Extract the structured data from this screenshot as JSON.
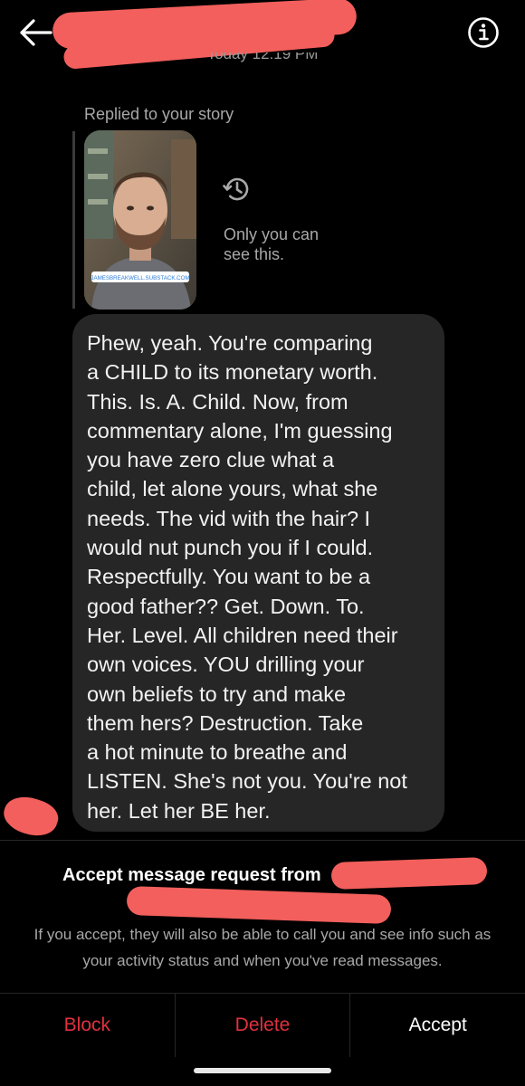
{
  "header": {
    "back_icon": "arrow-left-icon",
    "info_icon": "info-icon"
  },
  "thread": {
    "timestamp": "Today 12:19 PM",
    "reply_label": "Replied to your story",
    "story": {
      "link_label": "JAMESBREAKWELL.SUBSTACK.COM"
    },
    "history_icon": "history-icon",
    "only_you_text": "Only you can\nsee this.",
    "message": "Phew, yeah. You're comparing\na CHILD to its monetary worth.\nThis. Is. A. Child. Now, from\ncommentary alone, I'm guessing\nyou have zero clue what a\nchild, let alone yours, what she\nneeds. The vid with the hair? I\nwould nut punch you if I could.\nRespectfully. You want to be a\ngood father?? Get. Down. To.\nHer. Level. All children need their\nown voices. YOU drilling your\nown beliefs to try and make\nthem hers? Destruction. Take\na hot minute to breathe and\nLISTEN. She's not you. You're not\nher. Let her BE her."
  },
  "request": {
    "title": "Accept message request from",
    "description": "If you accept, they will also be able to call you and see info such as your activity status and when you've read messages."
  },
  "actions": {
    "block": "Block",
    "delete": "Delete",
    "accept": "Accept"
  },
  "colors": {
    "background": "#000000",
    "bubble": "#262626",
    "danger": "#e0313f",
    "redaction": "#f25f5c",
    "muted_text": "#a8a8a8"
  }
}
